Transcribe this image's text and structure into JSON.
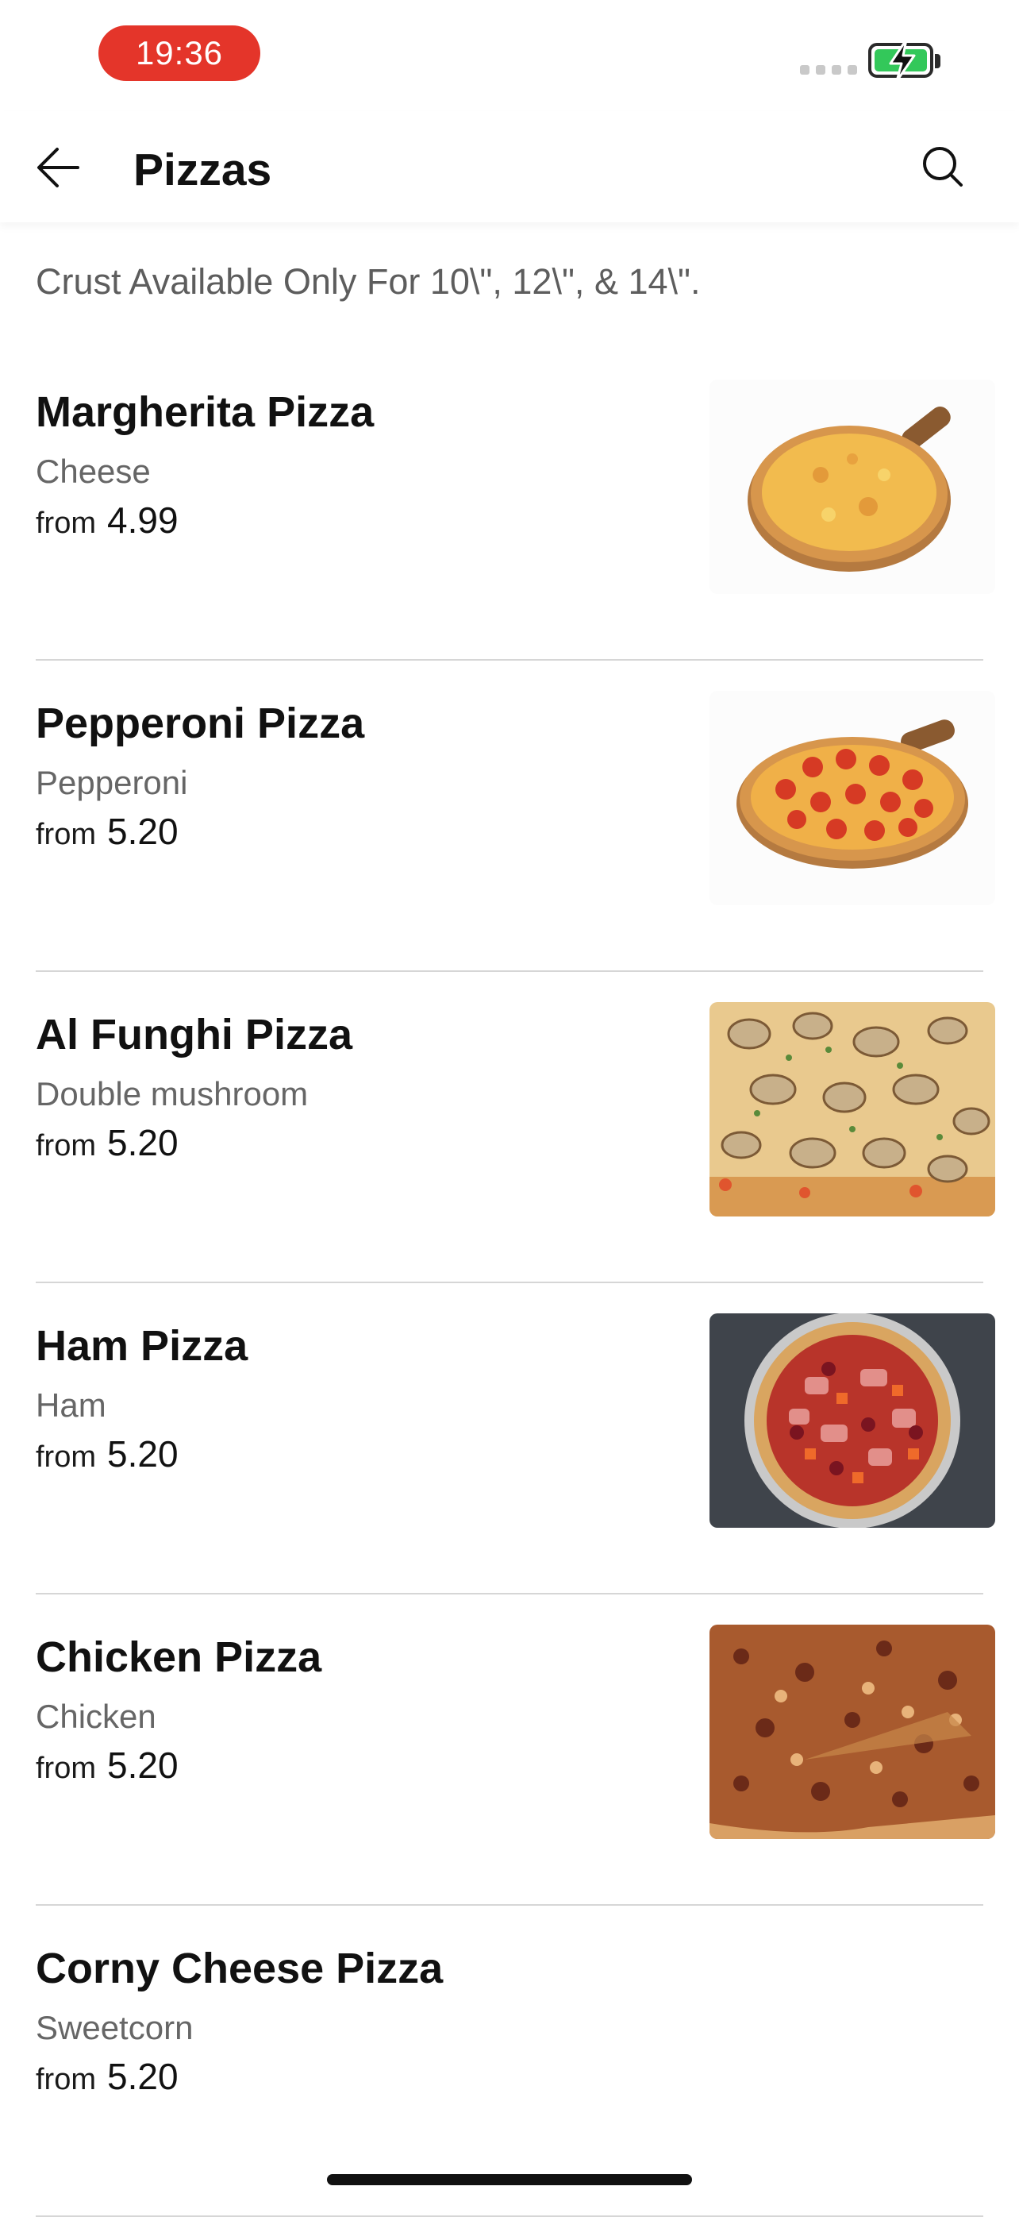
{
  "status_bar": {
    "time": "19:36",
    "battery_color": "#33c85a",
    "time_pill_color": "#e4352a"
  },
  "header": {
    "title": "Pizzas",
    "back_icon": "arrow-left-icon",
    "search_icon": "search-icon"
  },
  "notice": "Crust Available Only For 10\\\", 12\\\", & 14\\\".",
  "menu": {
    "items": [
      {
        "name": "Margherita Pizza",
        "description": "Cheese",
        "from_label": "from",
        "price": "4.99",
        "image": "margherita-pizza-photo"
      },
      {
        "name": "Pepperoni Pizza",
        "description": "Pepperoni",
        "from_label": "from",
        "price": "5.20",
        "image": "pepperoni-pizza-photo"
      },
      {
        "name": "Al Funghi Pizza",
        "description": "Double mushroom",
        "from_label": "from",
        "price": "5.20",
        "image": "mushroom-pizza-photo"
      },
      {
        "name": "Ham Pizza",
        "description": "Ham",
        "from_label": "from",
        "price": "5.20",
        "image": "ham-pizza-photo"
      },
      {
        "name": "Chicken Pizza",
        "description": "Chicken",
        "from_label": "from",
        "price": "5.20",
        "image": "chicken-pizza-photo"
      },
      {
        "name": "Corny Cheese Pizza",
        "description": "Sweetcorn",
        "from_label": "from",
        "price": "5.20",
        "image": ""
      }
    ]
  }
}
